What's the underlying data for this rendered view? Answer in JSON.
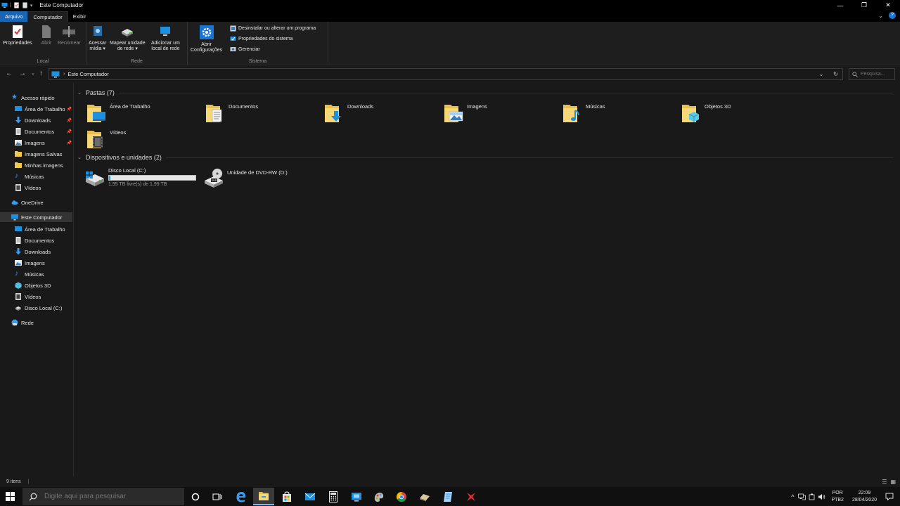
{
  "window": {
    "title": "Este Computador",
    "controls": {
      "minimize": "—",
      "maximize": "❐",
      "close": "✕"
    }
  },
  "ribbon_tabs": [
    {
      "label": "Arquivo"
    },
    {
      "label": "Computador"
    },
    {
      "label": "Exibir"
    }
  ],
  "ribbon": {
    "local": {
      "label": "Local",
      "buttons": [
        {
          "label": "Propriedades"
        },
        {
          "label": "Abrir"
        },
        {
          "label": "Renomear"
        }
      ]
    },
    "rede": {
      "label": "Rede",
      "buttons": [
        {
          "line1": "Acessar",
          "line2": "mídia ▾"
        },
        {
          "line1": "Mapear unidade",
          "line2": "de rede ▾"
        },
        {
          "line1": "Adicionar um",
          "line2": "local de rede"
        }
      ]
    },
    "sistema": {
      "label": "Sistema",
      "open_settings": {
        "line1": "Abrir",
        "line2": "Configurações"
      },
      "items": [
        {
          "label": "Desinstalar ou alterar um programa"
        },
        {
          "label": "Propriedades do sistema"
        },
        {
          "label": "Gerenciar"
        }
      ]
    }
  },
  "address": {
    "path": "Este Computador",
    "search_placeholder": "Pesquisa..."
  },
  "nav": {
    "quick_access": "Acesso rápido",
    "quick_items": [
      {
        "label": "Área de Trabalho",
        "pinned": true
      },
      {
        "label": "Downloads",
        "pinned": true
      },
      {
        "label": "Documentos",
        "pinned": true
      },
      {
        "label": "Imagens",
        "pinned": true
      },
      {
        "label": "Imagens Salvas",
        "pinned": false
      },
      {
        "label": "Minhas imagens",
        "pinned": false
      },
      {
        "label": "Músicas",
        "pinned": false
      },
      {
        "label": "Vídeos",
        "pinned": false
      }
    ],
    "onedrive": "OneDrive",
    "this_pc": "Este Computador",
    "pc_items": [
      {
        "label": "Área de Trabalho"
      },
      {
        "label": "Documentos"
      },
      {
        "label": "Downloads"
      },
      {
        "label": "Imagens"
      },
      {
        "label": "Músicas"
      },
      {
        "label": "Objetos 3D"
      },
      {
        "label": "Vídeos"
      },
      {
        "label": "Disco Local (C:)"
      }
    ],
    "network": "Rede"
  },
  "content": {
    "folders_header": "Pastas (7)",
    "folders": [
      {
        "label": "Área de Trabalho",
        "icon": "desktop-folder-icon"
      },
      {
        "label": "Documentos",
        "icon": "documents-folder-icon"
      },
      {
        "label": "Downloads",
        "icon": "downloads-folder-icon"
      },
      {
        "label": "Imagens",
        "icon": "pictures-folder-icon"
      },
      {
        "label": "Músicas",
        "icon": "music-folder-icon"
      },
      {
        "label": "Objetos 3D",
        "icon": "objects3d-folder-icon"
      },
      {
        "label": "Vídeos",
        "icon": "videos-folder-icon"
      }
    ],
    "devices_header": "Dispositivos e unidades (2)",
    "drives": [
      {
        "label": "Disco Local (C:)",
        "free_text": "1,95 TB livre(s) de 1,99 TB",
        "used_fraction": 0.02
      },
      {
        "label": "Unidade de DVD-RW (D:)"
      }
    ]
  },
  "status": {
    "items": "9 itens"
  },
  "taskbar": {
    "search_placeholder": "Digite aqui para pesquisar",
    "lang": "POR",
    "layout": "PTB2",
    "time": "22:09",
    "date": "28/04/2020"
  }
}
